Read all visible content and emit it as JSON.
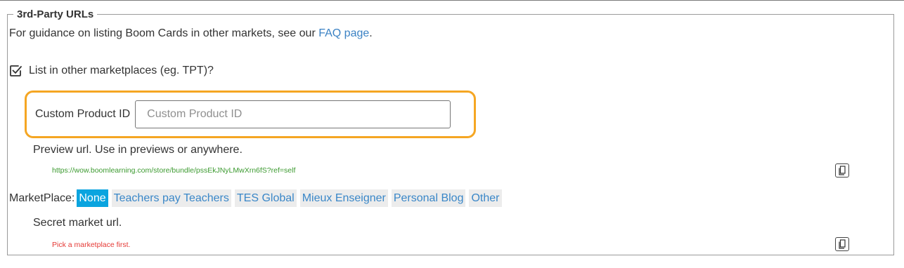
{
  "section": {
    "legend": "3rd-Party URLs"
  },
  "guidance": {
    "text": "For guidance on listing Boom Cards in other markets, see our ",
    "link_text": "FAQ page",
    "suffix": "."
  },
  "list_in_other": {
    "checked": true,
    "label": "List in other marketplaces (eg. TPT)?"
  },
  "custom_product_id": {
    "label": "Custom Product ID",
    "value": "",
    "placeholder": "Custom Product ID",
    "highlight_color": "#f5a623"
  },
  "preview": {
    "label": "Preview url. Use in previews or anywhere.",
    "url": "https://wow.boomlearning.com/store/bundle/pssEkJNyLMwXrn6fS?ref=self",
    "copy_icon": "copy-icon"
  },
  "marketplace": {
    "label": "MarketPlace:",
    "options": [
      "None",
      "Teachers pay Teachers",
      "TES Global",
      "Mieux Enseigner",
      "Personal Blog",
      "Other"
    ],
    "selected": "None",
    "selected_color": "#0aa4df"
  },
  "secret": {
    "label": "Secret market url.",
    "error": "Pick a marketplace first.",
    "copy_icon": "copy-icon"
  }
}
